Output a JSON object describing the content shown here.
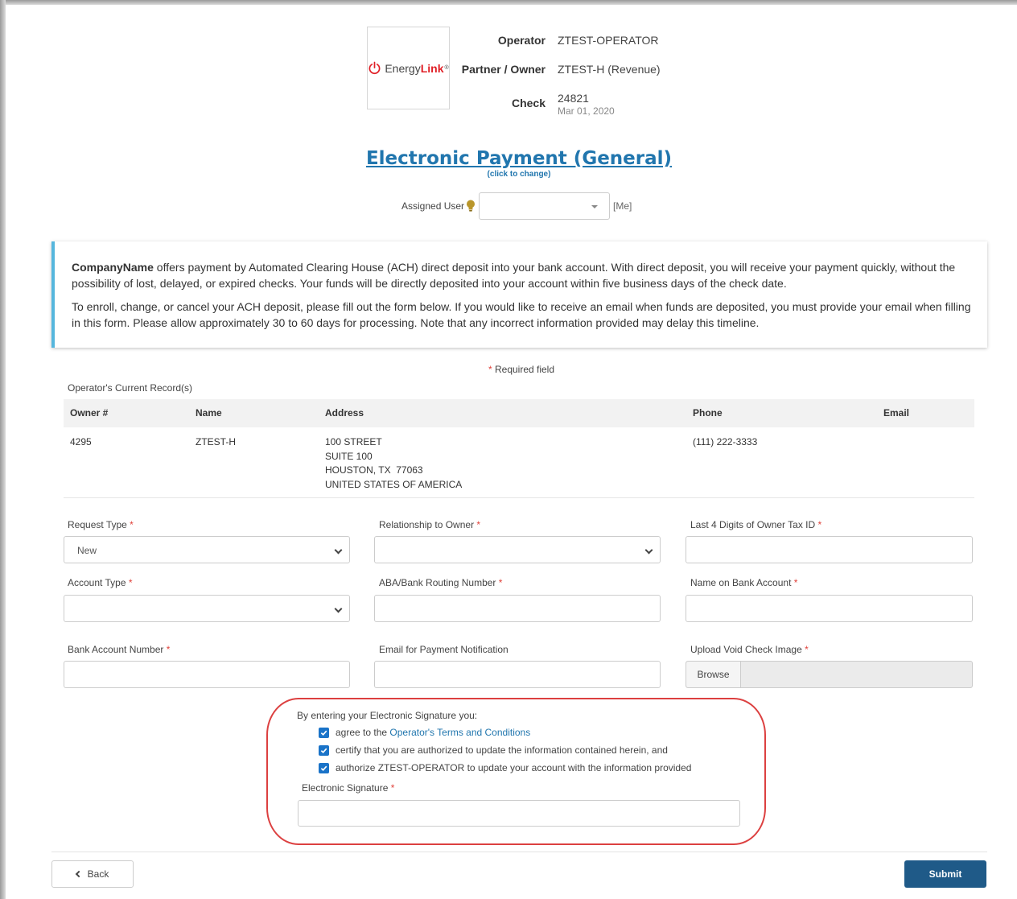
{
  "brand": {
    "name_part1": "Energy",
    "name_part2": "Link",
    "trademark": "®"
  },
  "header": {
    "operator_label": "Operator",
    "operator_value": "ZTEST-OPERATOR",
    "partner_label": "Partner / Owner",
    "partner_value": "ZTEST-H (Revenue)",
    "check_label": "Check",
    "check_number": "24821",
    "check_date": "Mar 01, 2020"
  },
  "title": {
    "text": "Electronic Payment (General)",
    "change_hint": "(click to change)"
  },
  "assigned_user": {
    "label": "Assigned User",
    "value": "",
    "me_link": "[Me]"
  },
  "info": {
    "company": "CompanyName",
    "para1_rest": " offers payment by Automated Clearing House (ACH) direct deposit into your bank account. With direct deposit, you will receive your payment quickly, without the possibility of lost, delayed, or expired checks. Your funds will be directly deposited into your account within five business days of the check date.",
    "para2": "To enroll, change, or cancel your ACH deposit, please fill out the form below. If you would like to receive an email when funds are deposited, you must provide your email when filling in this form. Please allow approximately 30 to 60 days for processing. Note that any incorrect information provided may delay this timeline."
  },
  "required_note": {
    "star": "*",
    "text": " Required field"
  },
  "records": {
    "caption": "Operator's Current Record(s)",
    "columns": [
      "Owner #",
      "Name",
      "Address",
      "Phone",
      "Email"
    ],
    "row": {
      "owner": "4295",
      "name": "ZTEST-H",
      "address": [
        "100 STREET",
        "SUITE 100",
        "HOUSTON, TX  77063",
        "UNITED STATES OF AMERICA"
      ],
      "phone": "(111) 222-3333",
      "email": ""
    }
  },
  "form": {
    "request_type": {
      "label": "Request Type",
      "value": "New"
    },
    "relationship": {
      "label": "Relationship to Owner",
      "value": ""
    },
    "tax_id": {
      "label": "Last 4 Digits of Owner Tax ID",
      "value": ""
    },
    "account_type": {
      "label": "Account Type",
      "value": ""
    },
    "routing": {
      "label": "ABA/Bank Routing Number",
      "value": ""
    },
    "name_on_account": {
      "label": "Name on Bank Account",
      "value": ""
    },
    "account_number": {
      "label": "Bank Account Number",
      "value": ""
    },
    "email": {
      "label": "Email for Payment Notification",
      "value": ""
    },
    "upload": {
      "label": "Upload Void Check Image",
      "button": "Browse"
    },
    "req_star": "*"
  },
  "signature": {
    "intro": "By entering your Electronic Signature you:",
    "c1_prefix": "agree to the ",
    "c1_link": "Operator's Terms and Conditions",
    "c2": "certify that you are authorized to update the information contained herein, and",
    "c3": "authorize ZTEST-OPERATOR to update your account with the information provided",
    "label": "Electronic Signature",
    "value": ""
  },
  "actions": {
    "back": "Back",
    "submit": "Submit"
  },
  "colors": {
    "accent": "#2176ae",
    "submit": "#1f5a88",
    "required": "#e0413a",
    "info_bar": "#55b6dd",
    "highlight_ring": "#dc4040"
  },
  "icons": [
    "power-icon",
    "lightbulb-icon",
    "caret-down-icon",
    "chevron-down-icon",
    "check-icon",
    "chevron-left-icon"
  ]
}
